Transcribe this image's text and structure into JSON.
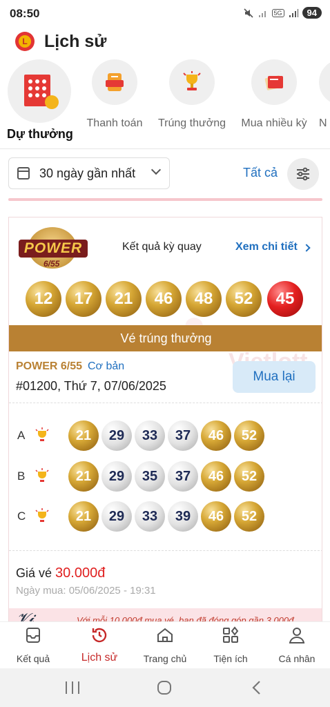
{
  "status": {
    "time": "08:50",
    "battery": "94",
    "network": "5G"
  },
  "header": {
    "title": "Lịch sử"
  },
  "categories": [
    {
      "label": "Dự thưởng",
      "icon": "ticket-icon",
      "active": true
    },
    {
      "label": "Thanh toán",
      "icon": "payment-icon"
    },
    {
      "label": "Trúng thưởng",
      "icon": "trophy-icon"
    },
    {
      "label": "Mua nhiều kỳ",
      "icon": "multi-ticket-icon"
    },
    {
      "label": "N"
    }
  ],
  "filter": {
    "period": "30 ngày gần nhất",
    "all_label": "Tất cả"
  },
  "card": {
    "logo_text": "POWER",
    "logo_sub": "6/55",
    "result_label": "Kết quả kỳ quay",
    "detail_link": "Xem chi tiết",
    "result_numbers": [
      "12",
      "17",
      "21",
      "46",
      "48",
      "52",
      "45"
    ],
    "banner": "Vé trúng thưởng",
    "product": "POWER 6/55",
    "product_type": "Cơ bản",
    "draw_info": "#01200,  Thứ 7, 07/06/2025",
    "buy_again": "Mua lại",
    "lines": [
      {
        "letter": "A",
        "numbers": [
          "21",
          "29",
          "33",
          "37",
          "46",
          "52"
        ],
        "matched": [
          true,
          false,
          false,
          false,
          true,
          true
        ]
      },
      {
        "letter": "B",
        "numbers": [
          "21",
          "29",
          "35",
          "37",
          "46",
          "52"
        ],
        "matched": [
          true,
          false,
          false,
          false,
          true,
          true
        ]
      },
      {
        "letter": "C",
        "numbers": [
          "21",
          "29",
          "33",
          "39",
          "46",
          "52"
        ],
        "matched": [
          true,
          false,
          false,
          false,
          true,
          true
        ]
      }
    ],
    "price_label": "Giá vé",
    "price_value": "30.000đ",
    "purchase_date": "Ngày mua: 05/06/2025 - 19:31",
    "promo_text": "Với mỗi 10.000đ mua vé, bạn đã đóng góp gần 3.000đ"
  },
  "bottom_nav": [
    {
      "label": "Kết quả",
      "icon": "results-icon"
    },
    {
      "label": "Lịch sử",
      "icon": "history-icon",
      "active": true
    },
    {
      "label": "Trang chủ",
      "icon": "home-icon"
    },
    {
      "label": "Tiện ích",
      "icon": "utilities-icon"
    },
    {
      "label": "Cá nhân",
      "icon": "profile-icon"
    }
  ],
  "colors": {
    "accent": "#c62828",
    "link": "#1f6fbf",
    "gold": "#b98133",
    "price": "#e02020"
  }
}
